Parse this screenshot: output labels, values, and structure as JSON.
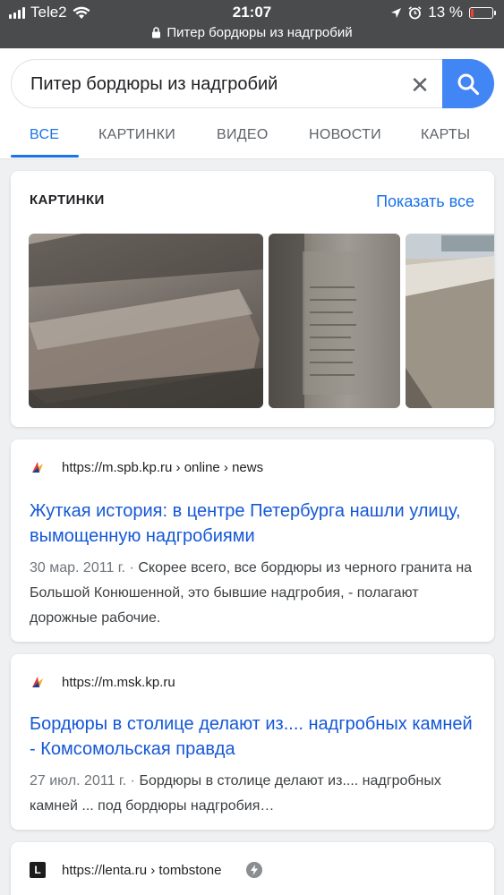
{
  "status_bar": {
    "carrier": "Tele2",
    "time": "21:07",
    "battery_percent": "13 %",
    "battery_level": 0.13,
    "url": "Питер бордюры из надгробий"
  },
  "search": {
    "query": "Питер бордюры из надгробий",
    "clear_symbol": "✕"
  },
  "tabs": [
    {
      "label": "ВСЕ",
      "active": true
    },
    {
      "label": "КАРТИНКИ",
      "active": false
    },
    {
      "label": "ВИДЕО",
      "active": false
    },
    {
      "label": "НОВОСТИ",
      "active": false
    },
    {
      "label": "КАРТЫ",
      "active": false
    }
  ],
  "images_section": {
    "title": "КАРТИНКИ",
    "show_all": "Показать все"
  },
  "results": [
    {
      "url": "https://m.spb.kp.ru › online › news",
      "title": "Жуткая история: в центре Петербурга нашли улицу, вымощенную надгробиями",
      "date": "30 мар. 2011 г. · ",
      "snippet": "Скорее всего, все бордюры из черного гранита на Большой Конюшенной, это бывшие надгробия, - полагают дорожные рабочие."
    },
    {
      "url": "https://m.msk.kp.ru",
      "title": "Бордюры в столице делают из.... надгробных камней - Комсомольская правда",
      "date": "27 июл. 2011 г. · ",
      "snippet": "Бордюры в столице делают из.... надгробных камней ... под бордюры надгробия…"
    },
    {
      "url": "https://lenta.ru › tombstone",
      "favicon_letter": "L"
    }
  ],
  "colors": {
    "accent": "#1a73e8",
    "search_button": "#4285f4",
    "link": "#1558d6",
    "status_bar": "#4a4b4d"
  }
}
